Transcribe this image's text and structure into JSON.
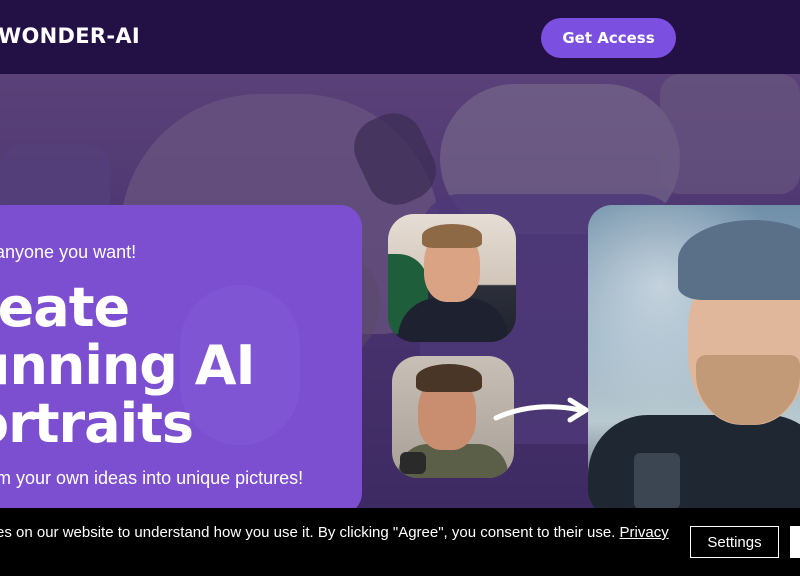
{
  "header": {
    "logo": "WONDER-AI",
    "cta_label": "Get Access"
  },
  "hero": {
    "tagline": "e anyone you want!",
    "headline_lines": [
      "reate",
      "unning AI",
      "ortraits"
    ],
    "subtext": "orm your own ideas into unique pictures!"
  },
  "cookie_banner": {
    "text": "es on our website to understand how you use it. By clicking \"Agree\", you consent to their use.",
    "privacy_link": "Privacy",
    "settings_label": "Settings"
  },
  "colors": {
    "header_bg": "#231044",
    "accent": "#7b4fe0",
    "card_bg": "#7c4fd1",
    "banner_bg": "#000000"
  }
}
